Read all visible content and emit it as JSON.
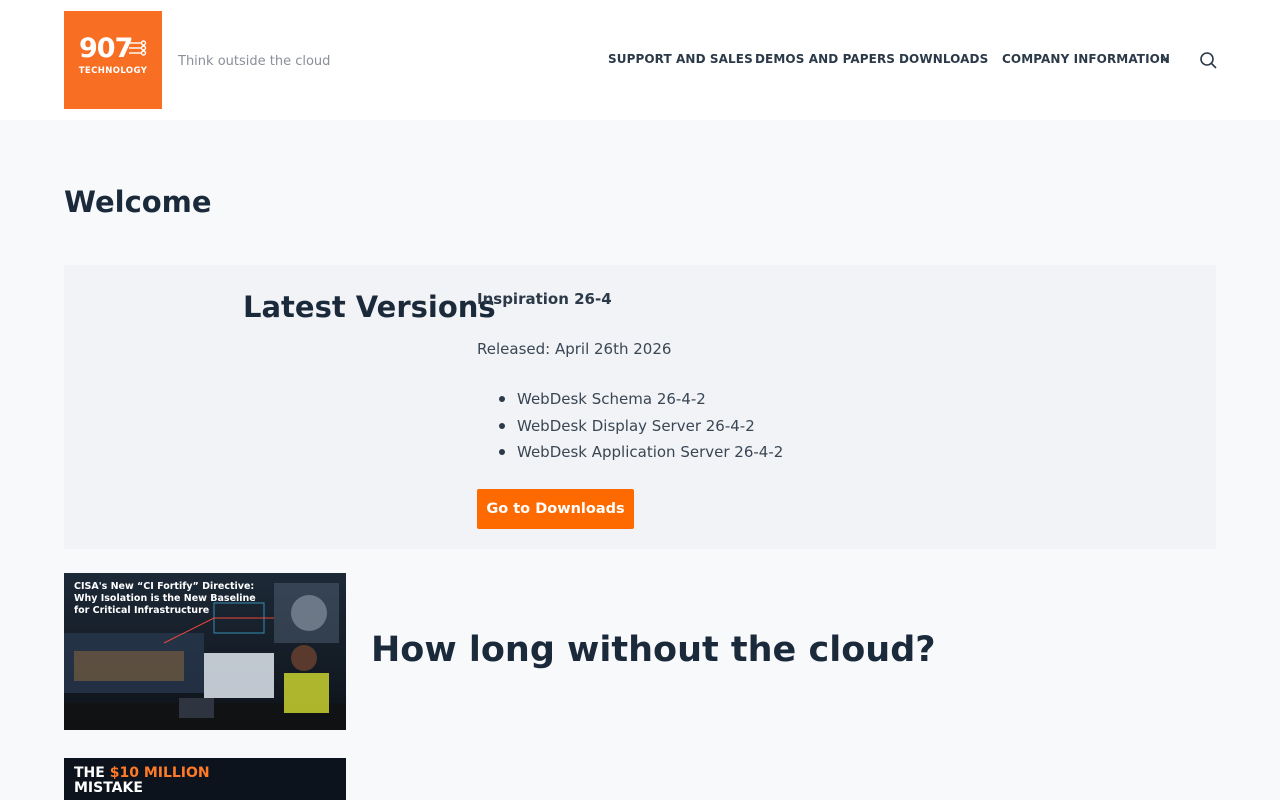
{
  "brand": {
    "logo_number": "907",
    "logo_subtitle": "TECHNOLOGY",
    "tagline": "Think outside the cloud",
    "color": "#f86e23"
  },
  "nav": {
    "items": [
      "SUPPORT AND SALES",
      "DEMOS AND PAPERS",
      "DOWNLOADS",
      "COMPANY INFORMATION"
    ],
    "dropdown_icon": "chevron-down-icon",
    "search_icon": "search-icon"
  },
  "main": {
    "heading": "Welcome",
    "latest": {
      "title": "Latest Versions",
      "release_name": "Inspiration 26-4",
      "released": "Released: April 26th 2026",
      "components": [
        "WebDesk Schema 26-4-2",
        "WebDesk Display Server 26-4-2",
        "WebDesk Application Server 26-4-2"
      ],
      "button_label": "Go to Downloads",
      "button_color": "#ff6a00"
    },
    "articles": [
      {
        "thumb_text": "CISA's New “CI Fortify” Directive: Why Isolation is the New Baseline for Critical Infrastructure",
        "title": "How long without the cloud?"
      },
      {
        "thumb_text_a": "THE ",
        "thumb_text_b": "$10 MILLION",
        "thumb_text_c": "MISTAKE"
      }
    ]
  }
}
